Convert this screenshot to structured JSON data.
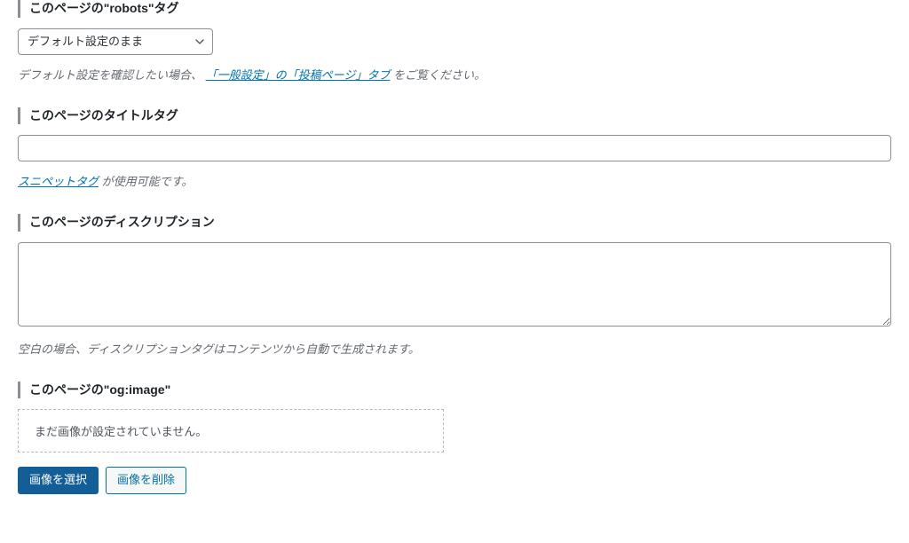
{
  "robots": {
    "heading": "このページの\"robots\"タグ",
    "selected": "デフォルト設定のまま",
    "help_prefix": "デフォルト設定を確認したい場合、",
    "help_link": "「一般設定」の「投稿ページ」タブ",
    "help_suffix": " をご覧ください。"
  },
  "title_tag": {
    "heading": "このページのタイトルタグ",
    "value": "",
    "help_link": "スニペットタグ",
    "help_suffix": " が使用可能です。"
  },
  "description": {
    "heading": "このページのディスクリプション",
    "value": "",
    "help": "空白の場合、ディスクリプションタグはコンテンツから自動で生成されます。"
  },
  "ogimage": {
    "heading": "このページの\"og:image\"",
    "placeholder": "まだ画像が設定されていません。",
    "select_button": "画像を選択",
    "delete_button": "画像を削除"
  }
}
